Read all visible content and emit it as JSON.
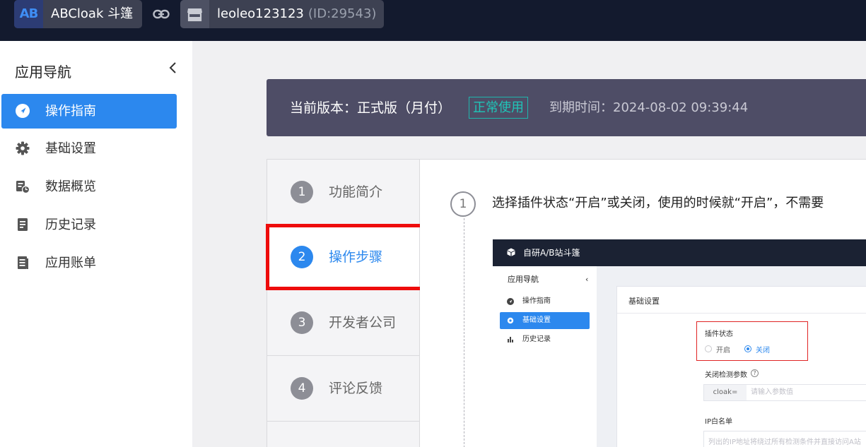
{
  "topbar": {
    "logo_text": "AB",
    "app_name": "ABCloak 斗篷",
    "user_name": "leoleo123123",
    "user_id": "(ID:29543)",
    "icons": [
      "link-icon",
      "store-icon"
    ]
  },
  "sidebar": {
    "title": "应用导航",
    "items": [
      {
        "label": "操作指南",
        "icon": "send-icon",
        "active": true
      },
      {
        "label": "基础设置",
        "icon": "gear-icon",
        "active": false
      },
      {
        "label": "数据概览",
        "icon": "data-report-icon",
        "active": false
      },
      {
        "label": "历史记录",
        "icon": "document-icon",
        "active": false
      },
      {
        "label": "应用账单",
        "icon": "bill-icon",
        "active": false
      }
    ]
  },
  "banner": {
    "version_text": "当前版本：正式版（月付）",
    "status": "正常使用",
    "expire_text": "到期时间：2024-08-02 09:39:44"
  },
  "steps": [
    {
      "num": "1",
      "label": "功能简介",
      "active": false
    },
    {
      "num": "2",
      "label": "操作步骤",
      "active": true
    },
    {
      "num": "3",
      "label": "开发者公司",
      "active": false
    },
    {
      "num": "4",
      "label": "评论反馈",
      "active": false
    }
  ],
  "content": {
    "step_num": "1",
    "instruction": "选择插件状态“开启”或关闭，使用的时候就“开启”，不需要"
  },
  "screenshot": {
    "title": "自研A/B站斗篷",
    "side_title": "应用导航",
    "nav": [
      {
        "label": "操作指南",
        "active": false
      },
      {
        "label": "基础设置",
        "active": true
      },
      {
        "label": "历史记录",
        "active": false
      }
    ],
    "card_title": "基础设置",
    "plugin_status_label": "插件状态",
    "option_on": "开启",
    "option_off": "关闭",
    "close_param_label": "关闭检测参数",
    "param_prefix": "cloak=",
    "param_placeholder": "请输入参数值",
    "ip_whitelist_label": "IP白名单",
    "ip_placeholder": "列出的IP地址将绕过所有检测条件并直接访问A站"
  },
  "colors": {
    "topbar_bg": "#131a2e",
    "accent_blue": "#2c88ee",
    "banner_bg": "#4e4d66",
    "status_teal": "#1fc5b8",
    "highlight_red": "#ee0c0c"
  }
}
